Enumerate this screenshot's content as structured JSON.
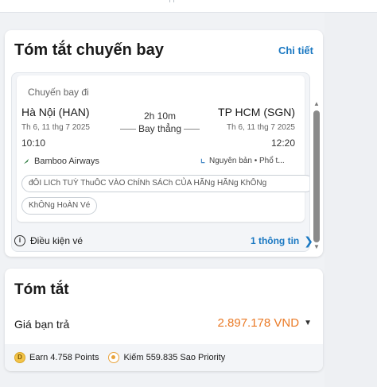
{
  "summary": {
    "title": "Tóm tắt chuyến bay",
    "detail_link": "Chi tiết",
    "flight": {
      "label": "Chuyến bay đi",
      "from_city": "Hà Nội (HAN)",
      "to_city": "TP HCM (SGN)",
      "from_date": "Th 6, 11 thg 7 2025",
      "to_date": "Th 6, 11 thg 7 2025",
      "depart_time": "10:10",
      "arrive_time": "12:20",
      "duration": "2h 10m",
      "stop_type": "Bay thẳng",
      "airline": "Bamboo Airways",
      "fare_class": "Nguyên bản • Phổ t...",
      "policy_chip_1": "đÔI LICh TUỲ ThuÔC VÀO ChÍNh SÁCh CỦA HÃNg HÃNg KhÔNg",
      "policy_chip_2": "KhÔNg HoÀN Vé"
    },
    "conditions_label": "Điều kiện vé",
    "conditions_link": "1 thông tin"
  },
  "total": {
    "title": "Tóm tắt",
    "price_label": "Giá bạn trả",
    "price_value": "2.897.178 VND",
    "earn_points": "Earn 4.758 Points",
    "earn_sao": "Kiếm 559.835 Sao Priority"
  },
  "icons": {
    "airline_logo": "bamboo-airways-logo",
    "fare_icon": "seat-class-icon",
    "info_icon": "info-circle-icon",
    "chevron_right": "chevron-right-icon",
    "chevron_down": "chevron-down-icon",
    "coin_icon": "points-coin-icon",
    "sao_icon": "sao-priority-icon"
  },
  "colors": {
    "link_blue": "#1a78c2",
    "price_orange": "#ea7a26",
    "coin_yellow": "#f3c44a"
  }
}
